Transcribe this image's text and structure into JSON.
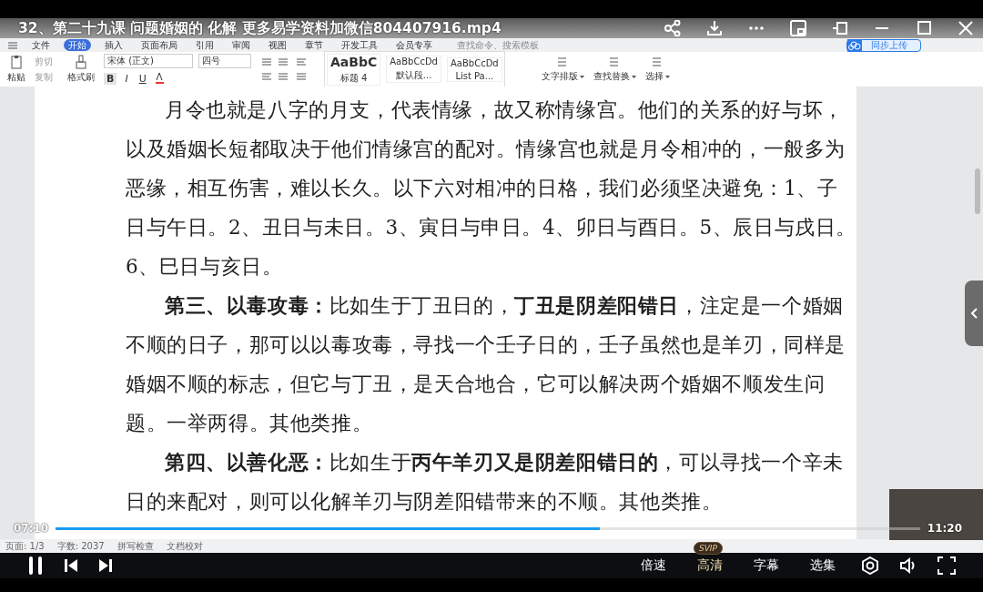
{
  "video": {
    "title": "32、第二十九课  问题婚姻的 化解 更多易学资料加微信804407916.mp4",
    "current_time": "07:10",
    "total_time": "11:20",
    "progress": {
      "level": 0.63
    },
    "controls": [
      {
        "label": "倍速"
      },
      {
        "label": "高清",
        "badge": "SVIP"
      },
      {
        "label": "字幕"
      },
      {
        "label": "选集"
      }
    ]
  },
  "wps": {
    "menu": [
      {
        "label": "文件",
        "selected": false
      },
      {
        "label": "开始",
        "selected": true
      },
      {
        "label": "插入",
        "selected": false
      },
      {
        "label": "页面布局",
        "selected": false
      },
      {
        "label": "引用",
        "selected": false
      },
      {
        "label": "审阅",
        "selected": false
      },
      {
        "label": "视图",
        "selected": false
      },
      {
        "label": "章节",
        "selected": false
      },
      {
        "label": "开发工具",
        "selected": false
      },
      {
        "label": "会员专享",
        "selected": false
      }
    ],
    "search": {
      "placeholder": "查找命令、搜索模板"
    },
    "upload_button": "同步上传",
    "clipboard": [
      {
        "label": "粘贴"
      },
      {
        "label": "剪切"
      },
      {
        "label": "复制"
      },
      {
        "label": "格式刷"
      }
    ],
    "font": {
      "name": "宋体 (正文)",
      "size": "四号"
    },
    "format_buttons": [
      "B",
      "I",
      "U"
    ],
    "styles": [
      {
        "sample": "AaBbC",
        "name": "标题 4"
      },
      {
        "sample": "AaBbCcDd",
        "name": "默认段..."
      },
      {
        "sample": "AaBbCcDd",
        "name": "List Pa..."
      }
    ],
    "tools": [
      {
        "label": "文字排版"
      },
      {
        "label": "查找替换"
      },
      {
        "label": "选择"
      }
    ],
    "document": {
      "paragraphs": [
        "月令也就是八字的月支，代表情缘，故又称情缘宫。他们的关系的好与坏，以及婚姻长短都取决于他们情缘宫的配对。情缘宫也就是月令相冲的，一般多为恶缘，相互伤害，难以长久。以下六对相冲的日格，我们必须坚决避免：1、子日与午日。2、丑日与未日。3、寅日与申日。4、卯日与酉日。5、辰日与戌日。6、巳日与亥日。",
        "**第三、以毒攻毒：**比如生于丁丑日的，**丁丑是阴差阳错日**，注定是一个婚姻不顺的日子，那可以以毒攻毒，寻找一个壬子日的，壬子虽然也是羊刃，同样是婚姻不顺的标志，但它与丁丑，是天合地合，它可以解决两个婚姻不顺发生问题。一举两得。其他类推。",
        "**第四、以善化恶：**比如生于**丙午羊刃又是阴差阳错日的**，可以寻找一个辛未日的来配对，则可以化解羊刃与阴差阳错带来的不顺。其他类推。"
      ]
    },
    "status_bar": {
      "page": "页面: 1/3",
      "words": "字数: 2037",
      "spell_check": "拼写检查",
      "proofread": "文档校对"
    }
  }
}
